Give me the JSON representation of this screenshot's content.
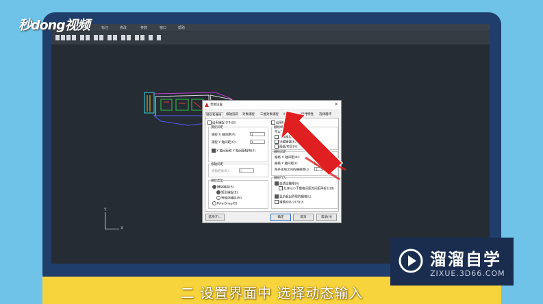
{
  "watermark": {
    "brand": "秒dong视频"
  },
  "cad": {
    "menu": [
      "",
      "",
      "绘图",
      "标注",
      "修改",
      "参数",
      "窗口",
      "帮助"
    ],
    "toolbar_icons": [
      "new-icon",
      "open-icon",
      "save-icon",
      "print-icon",
      "undo-icon",
      "redo-icon",
      "pan-icon",
      "zoom-icon",
      "layer-icon",
      "properties-icon",
      "match-icon",
      "block-icon",
      "table-icon",
      "text-icon",
      "calc-icon",
      "help-icon"
    ],
    "axis": {
      "y": "Y",
      "x": "X"
    }
  },
  "dialog": {
    "title": "草图设置",
    "close": "×",
    "tabs": [
      "捕捉和栅格",
      "极轴追踪",
      "对象捕捉",
      "三维对象捕捉",
      "动态输入",
      "快捷特性",
      "选择循环"
    ],
    "active_tab_index": 0,
    "enable_snap": "启用捕捉 (F9)(S)",
    "snap_spacing": {
      "group": "捕捉间距",
      "x_label": "捕捉 X 轴间距(P):",
      "x_value": "1",
      "y_label": "捕捉 Y 轴间距(C):",
      "y_value": "1",
      "equal": "X 轴间距和 Y 轴间距相等(X)"
    },
    "polar_spacing": {
      "group": "极轴间距",
      "label": "极轴距离(D):",
      "value": "0"
    },
    "snap_type": {
      "group": "捕捉类型",
      "grid": "栅格捕捉(R)",
      "rect": "矩形捕捉(E)",
      "iso": "等轴测捕捉(M)",
      "polar": "PolarSnap(O)"
    },
    "enable_grid": "启用栅格 (F7)(G)",
    "grid_style": {
      "group": "栅格样式",
      "desc": "在以下位置显示点栅格:",
      "model": "二维模型空间(D)",
      "block": "块编辑器(K)",
      "sheet": "图纸/布局(H)"
    },
    "grid_spacing": {
      "group": "栅格间距",
      "x_label": "栅格 X 轴间距(N):",
      "x_value": "1",
      "y_label": "栅格 Y 轴间距(I):",
      "y_value": "1",
      "major_label": "每条主线之间的栅格数(J):",
      "major_value": "5"
    },
    "grid_behavior": {
      "group": "栅格行为",
      "adaptive": "自适应栅格(A)",
      "subdivide": "允许以小于栅格间距的间距再拆分(B)",
      "beyond": "显示超出界限的栅格(L)",
      "follow": "遵循动态 UCS(U)"
    },
    "buttons": {
      "options": "选项(T)...",
      "ok": "确定",
      "cancel": "取消",
      "help": "帮助(H)"
    }
  },
  "subtitle": "二 设置界面中 选择动态输入",
  "brand": {
    "cn": "溜溜自学",
    "en": "ZIXUE.3D66.COM"
  },
  "colors": {
    "frame": "#1f3e6b",
    "background": "#6fc3e9",
    "subtitle_bar": "#f7d33c",
    "arrow": "#e02020",
    "brand_bg": "#1b2d4f"
  }
}
